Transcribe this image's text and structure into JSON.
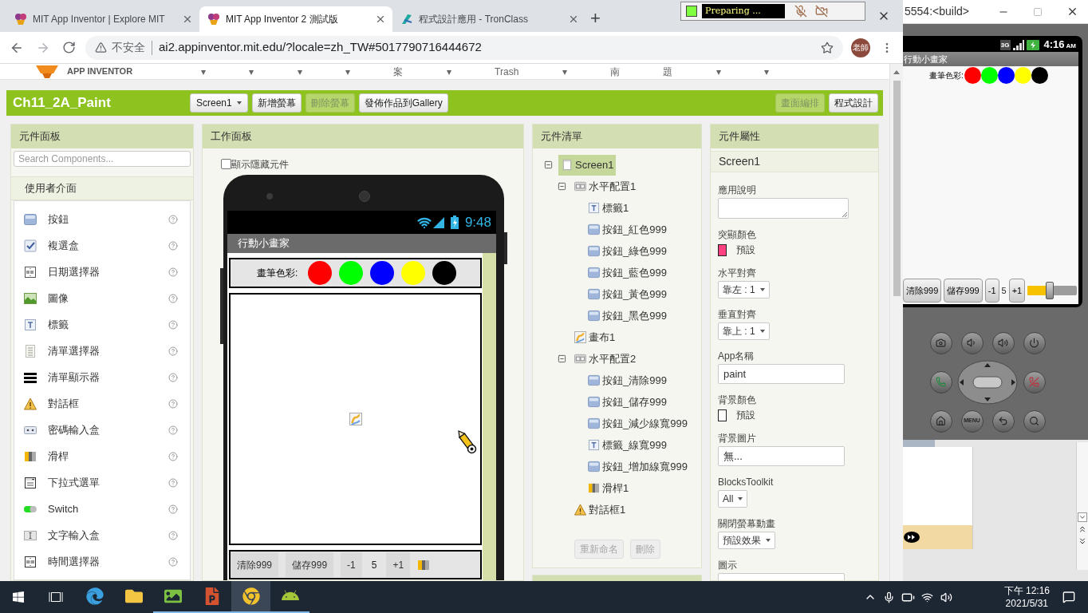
{
  "browser": {
    "tabs": [
      {
        "kind": "appinventor",
        "title": "MIT App Inventor | Explore MIT",
        "selected": false
      },
      {
        "kind": "appinventor",
        "title": "MIT App Inventor 2 測試版",
        "selected": true
      },
      {
        "kind": "tronclass",
        "title": "程式設計應用 - TronClass",
        "selected": false
      }
    ],
    "new_tab": "+",
    "security": "不安全",
    "url": "ai2.appinventor.mit.edu/?locale=zh_TW#5017790716444672",
    "profile": "老師"
  },
  "recorder": {
    "status": "Preparing ..."
  },
  "nav": {
    "logo": "APP INVENTOR",
    "items": [
      "▾",
      "▾",
      "▾",
      "▾",
      "案",
      "▾",
      "Trash",
      "▾",
      "南",
      "題",
      "▾",
      "▾"
    ]
  },
  "toolbar": {
    "project": "Ch11_2A_Paint",
    "screen": "Screen1",
    "buttons": [
      {
        "label": "新增螢幕",
        "disabled": false
      },
      {
        "label": "刪除螢幕",
        "disabled": true
      },
      {
        "label": "發佈作品到Gallery",
        "disabled": false
      }
    ],
    "views": [
      {
        "label": "畫面編排",
        "selected": true
      },
      {
        "label": "程式設計",
        "selected": false
      }
    ]
  },
  "palette": {
    "title": "元件面板",
    "search_placeholder": "Search Components...",
    "category": "使用者介面",
    "items": [
      {
        "kind": "button",
        "label": "按鈕"
      },
      {
        "kind": "checkbox",
        "label": "複選盒"
      },
      {
        "kind": "datepicker",
        "label": "日期選擇器"
      },
      {
        "kind": "image",
        "label": "圖像"
      },
      {
        "kind": "label",
        "label": "標籤"
      },
      {
        "kind": "listpicker",
        "label": "清單選擇器"
      },
      {
        "kind": "listview",
        "label": "清單顯示器"
      },
      {
        "kind": "notifier",
        "label": "對話框"
      },
      {
        "kind": "password",
        "label": "密碼輸入盒"
      },
      {
        "kind": "slider",
        "label": "滑桿"
      },
      {
        "kind": "spinner",
        "label": "下拉式選單"
      },
      {
        "kind": "switch",
        "label": "Switch"
      },
      {
        "kind": "textbox",
        "label": "文字輸入盒"
      },
      {
        "kind": "timepicker",
        "label": "時間選擇器"
      }
    ]
  },
  "viewer": {
    "title": "工作面板",
    "show_hidden": {
      "label": "顯示隱藏元件",
      "checked": false
    },
    "phone": {
      "time": "9:48",
      "app_title": "行動小畫家",
      "color_label": "畫筆色彩:",
      "colors": [
        {
          "color": "#ff0000"
        },
        {
          "color": "#00ff00"
        },
        {
          "color": "#0000ff"
        },
        {
          "color": "#ffff00"
        },
        {
          "color": "#000000"
        }
      ],
      "controls": [
        {
          "kind": "button",
          "text": "清除999"
        },
        {
          "kind": "button",
          "text": "儲存999"
        },
        {
          "kind": "button",
          "text": "-1"
        },
        {
          "kind": "label",
          "text": "5"
        },
        {
          "kind": "button",
          "text": "+1"
        },
        {
          "kind": "slider"
        }
      ]
    }
  },
  "tree": {
    "title": "元件清單",
    "root": {
      "kind": "screen",
      "label": "Screen1",
      "selected": true,
      "expanded": true,
      "children": [
        {
          "kind": "arrangement",
          "label": "水平配置1",
          "selected": false,
          "expanded": true,
          "children": [
            {
              "kind": "label",
              "label": "標籤1",
              "selected": false
            },
            {
              "kind": "button",
              "label": "按鈕_紅色999",
              "selected": false
            },
            {
              "kind": "button",
              "label": "按鈕_綠色999",
              "selected": false
            },
            {
              "kind": "button",
              "label": "按鈕_藍色999",
              "selected": false
            },
            {
              "kind": "button",
              "label": "按鈕_黃色999",
              "selected": false
            },
            {
              "kind": "button",
              "label": "按鈕_黑色999",
              "selected": false
            }
          ]
        },
        {
          "kind": "canvas",
          "label": "畫布1",
          "selected": false
        },
        {
          "kind": "arrangement",
          "label": "水平配置2",
          "selected": false,
          "expanded": true,
          "children": [
            {
              "kind": "button",
              "label": "按鈕_清除999",
              "selected": false
            },
            {
              "kind": "button",
              "label": "按鈕_儲存999",
              "selected": false
            },
            {
              "kind": "button",
              "label": "按鈕_減少線寬999",
              "selected": false
            },
            {
              "kind": "label",
              "label": "標籤_線寬999",
              "selected": false
            },
            {
              "kind": "button",
              "label": "按鈕_增加線寬999",
              "selected": false
            },
            {
              "kind": "slider",
              "label": "滑桿1",
              "selected": false
            }
          ]
        },
        {
          "kind": "notifier",
          "label": "對話框1",
          "selected": false
        }
      ]
    },
    "buttons": [
      {
        "label": "重新命名",
        "disabled": true
      },
      {
        "label": "刪除",
        "disabled": true
      }
    ]
  },
  "properties": {
    "title": "元件屬性",
    "component": "Screen1",
    "items": [
      {
        "kind": "textarea",
        "label": "應用說明"
      },
      {
        "kind": "color",
        "label": "突顯顏色",
        "value": "預設",
        "color": "#ff4081"
      },
      {
        "kind": "dropdown",
        "label": "水平對齊",
        "value": "靠左 : 1"
      },
      {
        "kind": "dropdown",
        "label": "垂直對齊",
        "value": "靠上 : 1"
      },
      {
        "kind": "text",
        "label": "App名稱",
        "value": "paint"
      },
      {
        "kind": "color",
        "label": "背景顏色",
        "value": "預設",
        "color": "#ffffff"
      },
      {
        "kind": "text",
        "label": "背景圖片",
        "value": "無..."
      },
      {
        "kind": "dropdown",
        "label": "BlocksToolkit",
        "value": "All"
      },
      {
        "kind": "dropdown",
        "label": "關閉螢幕動畫",
        "value": "預設效果"
      },
      {
        "kind": "text",
        "label": "圖示"
      }
    ]
  },
  "emulator": {
    "title": "5554:<build>",
    "phone": {
      "network": "3G",
      "time": "4:16",
      "time_suffix": "AM",
      "app_title": "行動小畫家",
      "color_label": "畫筆色彩:",
      "colors": [
        {
          "color": "#ff0000"
        },
        {
          "color": "#00ff00"
        },
        {
          "color": "#0000ff"
        },
        {
          "color": "#ffff00"
        },
        {
          "color": "#000000"
        }
      ],
      "controls": [
        {
          "kind": "button",
          "text": "清除999"
        },
        {
          "kind": "button",
          "text": "儲存999"
        },
        {
          "kind": "button",
          "text": "-1"
        },
        {
          "kind": "label",
          "text": "5"
        },
        {
          "kind": "button",
          "text": "+1"
        },
        {
          "kind": "slider",
          "level": 0.45
        }
      ]
    },
    "menu_key": "MENU"
  },
  "taskbar": {
    "apps": [
      {
        "kind": "edge",
        "running": false,
        "selected": false
      },
      {
        "kind": "explorer",
        "running": false,
        "selected": false
      },
      {
        "kind": "photos",
        "running": true,
        "selected": false
      },
      {
        "kind": "powerpoint",
        "running": true,
        "selected": false
      },
      {
        "kind": "chrome",
        "running": true,
        "selected": true
      },
      {
        "kind": "android",
        "running": true,
        "selected": false
      }
    ],
    "time": "下午 12:16",
    "date": "2021/5/31"
  }
}
